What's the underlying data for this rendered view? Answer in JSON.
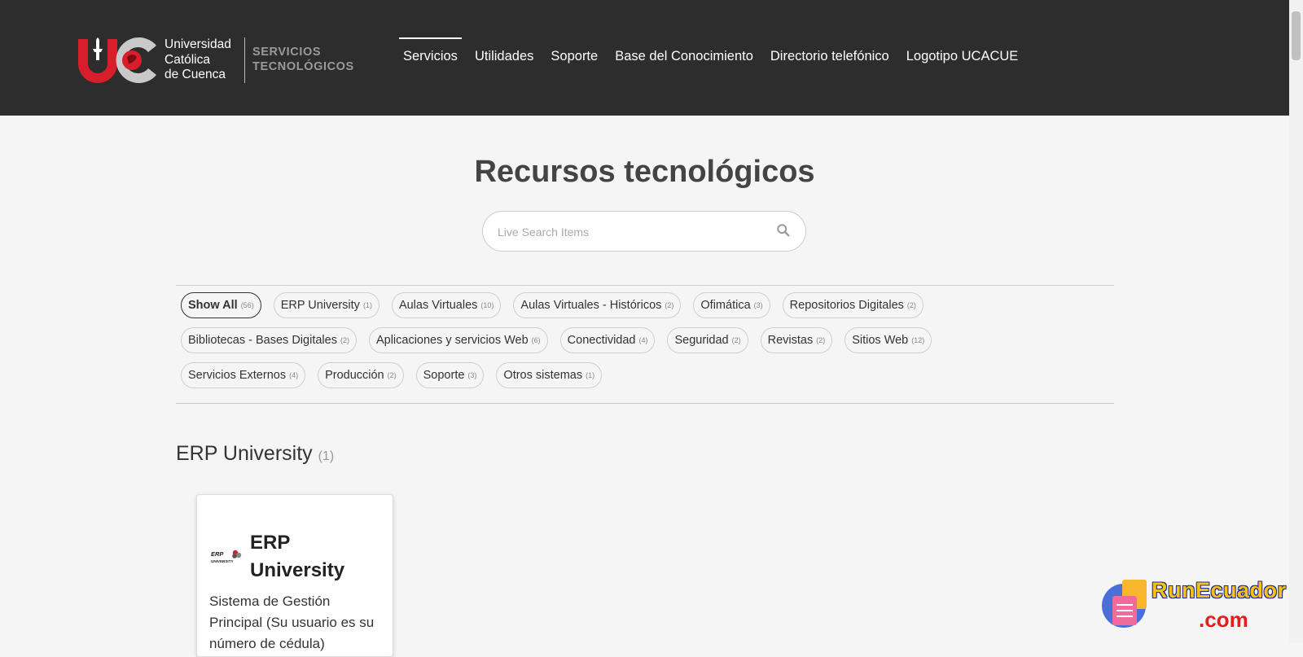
{
  "header": {
    "logo_line1": "Universidad",
    "logo_line2": "Católica",
    "logo_line3": "de Cuenca",
    "services_line1": "SERVICIOS",
    "services_line2": "TECNOLÓGICOS",
    "nav": [
      {
        "label": "Servicios",
        "active": true
      },
      {
        "label": "Utilidades"
      },
      {
        "label": "Soporte"
      },
      {
        "label": "Base del Conocimiento"
      },
      {
        "label": "Directorio telefónico"
      },
      {
        "label": "Logotipo UCACUE"
      }
    ]
  },
  "main": {
    "title": "Recursos tecnológicos",
    "search": {
      "placeholder": "Live Search Items",
      "value": ""
    },
    "filters": [
      {
        "label": "Show All",
        "count": "(56)"
      },
      {
        "label": "ERP University",
        "count": "(1)"
      },
      {
        "label": "Aulas Virtuales",
        "count": "(10)"
      },
      {
        "label": "Aulas Virtuales - Históricos",
        "count": "(2)"
      },
      {
        "label": "Ofimática",
        "count": "(3)"
      },
      {
        "label": "Repositorios Digitales",
        "count": "(2)"
      },
      {
        "label": "Bibliotecas - Bases Digitales",
        "count": "(2)"
      },
      {
        "label": "Aplicaciones y servicios Web",
        "count": "(6)"
      },
      {
        "label": "Conectividad",
        "count": "(4)"
      },
      {
        "label": "Seguridad",
        "count": "(2)"
      },
      {
        "label": "Revistas",
        "count": "(2)"
      },
      {
        "label": "Sitios Web",
        "count": "(12)"
      },
      {
        "label": "Servicios Externos",
        "count": "(4)"
      },
      {
        "label": "Producción",
        "count": "(2)"
      },
      {
        "label": "Soporte",
        "count": "(3)"
      },
      {
        "label": "Otros sistemas",
        "count": "(1)"
      }
    ],
    "section": {
      "title": "ERP University",
      "count": "(1)"
    },
    "card": {
      "logo_text": "ERP UNIVERSITY",
      "title": "ERP University",
      "description": "Sistema de Gestión Principal (Su usuario es su número de cédula)"
    }
  },
  "watermark": {
    "line1": "RunEcuador",
    "line2": ".com"
  },
  "colors": {
    "header_bg": "#2d2d2d",
    "brand_red": "#d81e2a",
    "page_bg": "#f5f5f5"
  }
}
